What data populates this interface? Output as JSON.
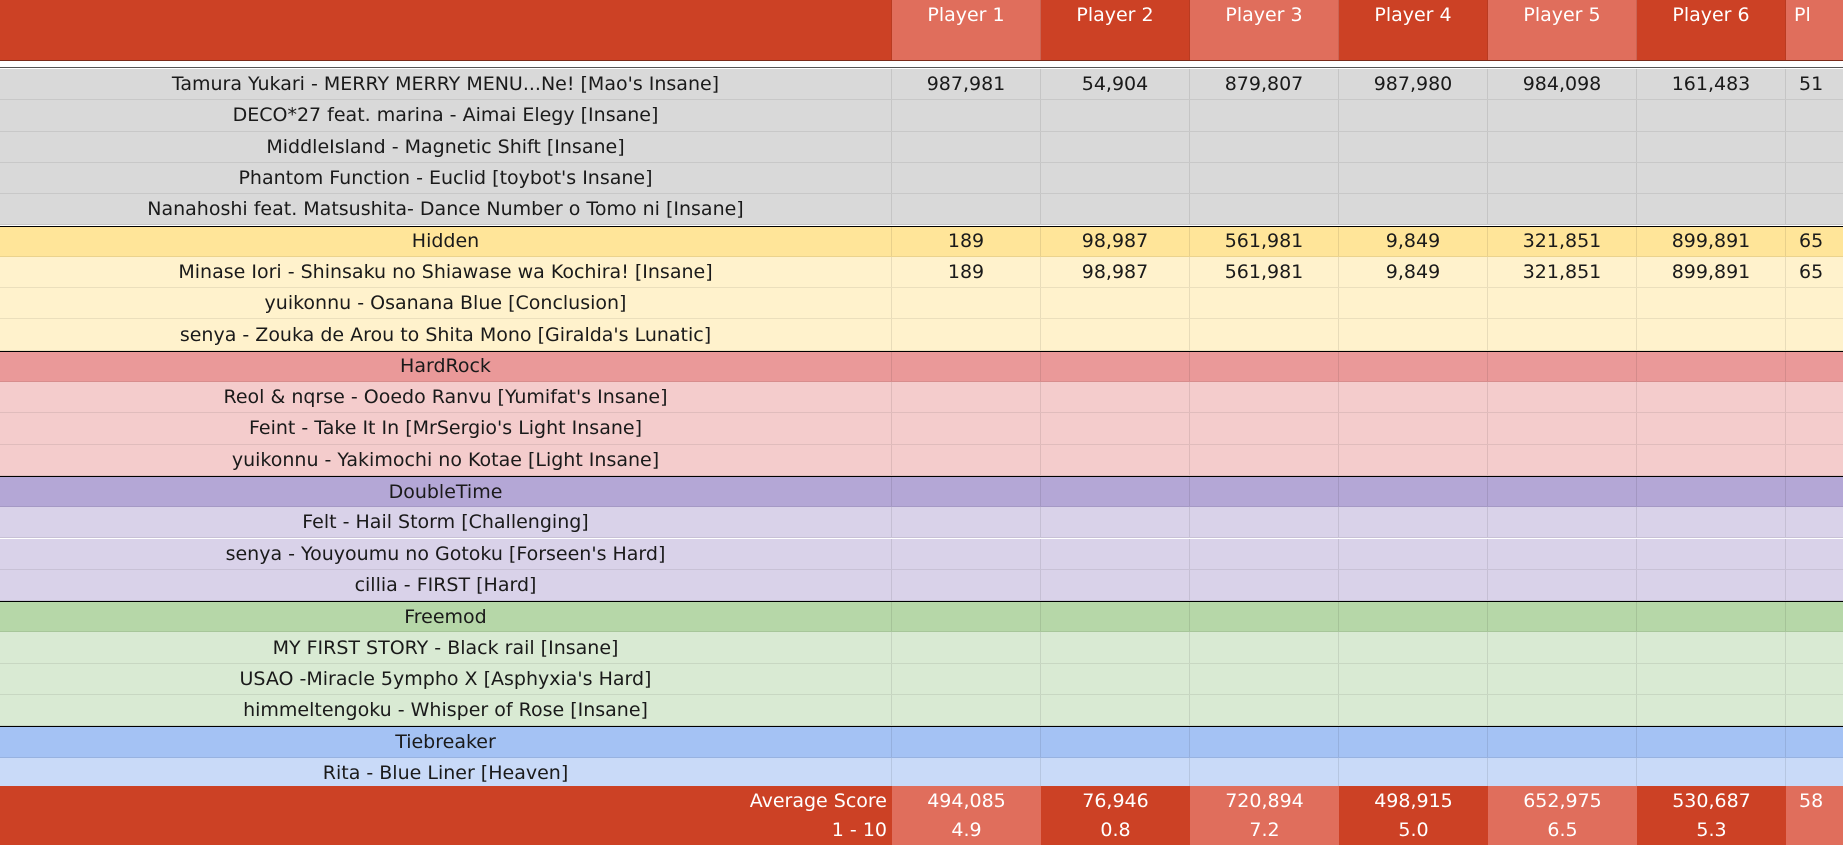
{
  "colors": {
    "header_dark": "#CC4125",
    "header_light": "#E06E5C",
    "nm_bg": "#D9D9D9",
    "hd_header": "#FFE599",
    "hd_row": "#FFF2CC",
    "hr_header": "#EA9999",
    "hr_row": "#F4CCCC",
    "dt_header": "#B4A7D6",
    "dt_row": "#D9D2E9",
    "fm_header": "#B6D7A8",
    "fm_row": "#D9EAD3",
    "tb_header": "#A4C2F4",
    "tb_row": "#C9DAF8"
  },
  "header": {
    "players": [
      "Player 1",
      "Player 2",
      "Player 3",
      "Player 4",
      "Player 5",
      "Player 6",
      "Pl"
    ]
  },
  "rows": [
    {
      "kind": "map",
      "group": "nm",
      "label": "Tamura Yukari - MERRY MERRY MENU...Ne! [Mao's Insane]",
      "values": [
        "987,981",
        "54,904",
        "879,807",
        "987,980",
        "984,098",
        "161,483",
        "51"
      ]
    },
    {
      "kind": "map",
      "group": "nm",
      "label": "DECO*27 feat. marina - Aimai Elegy [Insane]",
      "values": [
        "",
        "",
        "",
        "",
        "",
        "",
        ""
      ]
    },
    {
      "kind": "map",
      "group": "nm",
      "label": "MiddleIsland - Magnetic Shift [Insane]",
      "values": [
        "",
        "",
        "",
        "",
        "",
        "",
        ""
      ]
    },
    {
      "kind": "map",
      "group": "nm",
      "label": "Phantom Function - Euclid [toybot's Insane]",
      "values": [
        "",
        "",
        "",
        "",
        "",
        "",
        ""
      ]
    },
    {
      "kind": "map",
      "group": "nm",
      "label": "Nanahoshi feat. Matsushita- Dance Number o Tomo ni [Insane]",
      "values": [
        "",
        "",
        "",
        "",
        "",
        "",
        ""
      ]
    },
    {
      "kind": "section",
      "group": "hd",
      "label": "Hidden",
      "values": [
        "189",
        "98,987",
        "561,981",
        "9,849",
        "321,851",
        "899,891",
        "65"
      ]
    },
    {
      "kind": "map",
      "group": "hd",
      "label": "Minase Iori - Shinsaku no Shiawase wa Kochira! [Insane]",
      "values": [
        "189",
        "98,987",
        "561,981",
        "9,849",
        "321,851",
        "899,891",
        "65"
      ]
    },
    {
      "kind": "map",
      "group": "hd",
      "label": "yuikonnu - Osanana Blue [Conclusion]",
      "values": [
        "",
        "",
        "",
        "",
        "",
        "",
        ""
      ]
    },
    {
      "kind": "map",
      "group": "hd",
      "label": "senya - Zouka de Arou to Shita Mono [Giralda's Lunatic]",
      "values": [
        "",
        "",
        "",
        "",
        "",
        "",
        ""
      ]
    },
    {
      "kind": "section",
      "group": "hr",
      "label": "HardRock",
      "values": [
        "",
        "",
        "",
        "",
        "",
        "",
        ""
      ]
    },
    {
      "kind": "map",
      "group": "hr",
      "label": "Reol & nqrse - Ooedo Ranvu [Yumifat's Insane]",
      "values": [
        "",
        "",
        "",
        "",
        "",
        "",
        ""
      ]
    },
    {
      "kind": "map",
      "group": "hr",
      "label": "Feint - Take It In [MrSergio's Light Insane]",
      "values": [
        "",
        "",
        "",
        "",
        "",
        "",
        ""
      ]
    },
    {
      "kind": "map",
      "group": "hr",
      "label": "yuikonnu - Yakimochi no Kotae [Light Insane]",
      "values": [
        "",
        "",
        "",
        "",
        "",
        "",
        ""
      ]
    },
    {
      "kind": "section",
      "group": "dt",
      "label": "DoubleTime",
      "values": [
        "",
        "",
        "",
        "",
        "",
        "",
        ""
      ]
    },
    {
      "kind": "map",
      "group": "dt",
      "label": "Felt - Hail Storm [Challenging]",
      "values": [
        "",
        "",
        "",
        "",
        "",
        "",
        ""
      ]
    },
    {
      "kind": "map",
      "group": "dt",
      "label": "senya - Youyoumu no Gotoku [Forseen's Hard]",
      "values": [
        "",
        "",
        "",
        "",
        "",
        "",
        ""
      ]
    },
    {
      "kind": "map",
      "group": "dt",
      "label": "cillia - FIRST [Hard]",
      "values": [
        "",
        "",
        "",
        "",
        "",
        "",
        ""
      ]
    },
    {
      "kind": "section",
      "group": "fm",
      "label": "Freemod",
      "values": [
        "",
        "",
        "",
        "",
        "",
        "",
        ""
      ]
    },
    {
      "kind": "map",
      "group": "fm",
      "label": "MY FIRST STORY - Black rail [Insane]",
      "values": [
        "",
        "",
        "",
        "",
        "",
        "",
        ""
      ]
    },
    {
      "kind": "map",
      "group": "fm",
      "label": "USAO -Miracle 5ympho X [Asphyxia's Hard]",
      "values": [
        "",
        "",
        "",
        "",
        "",
        "",
        ""
      ]
    },
    {
      "kind": "map",
      "group": "fm",
      "label": "himmeltengoku - Whisper of Rose [Insane]",
      "values": [
        "",
        "",
        "",
        "",
        "",
        "",
        ""
      ]
    },
    {
      "kind": "section",
      "group": "tb",
      "label": "Tiebreaker",
      "values": [
        "",
        "",
        "",
        "",
        "",
        "",
        ""
      ]
    },
    {
      "kind": "map",
      "group": "tb",
      "label": "Rita - Blue Liner [Heaven]",
      "values": [
        "",
        "",
        "",
        "",
        "",
        "",
        ""
      ]
    }
  ],
  "footer": [
    {
      "label": "Average Score",
      "values": [
        "494,085",
        "76,946",
        "720,894",
        "498,915",
        "652,975",
        "530,687",
        "58"
      ]
    },
    {
      "label": "1 - 10",
      "values": [
        "4.9",
        "0.8",
        "7.2",
        "5.0",
        "6.5",
        "5.3",
        ""
      ]
    }
  ]
}
